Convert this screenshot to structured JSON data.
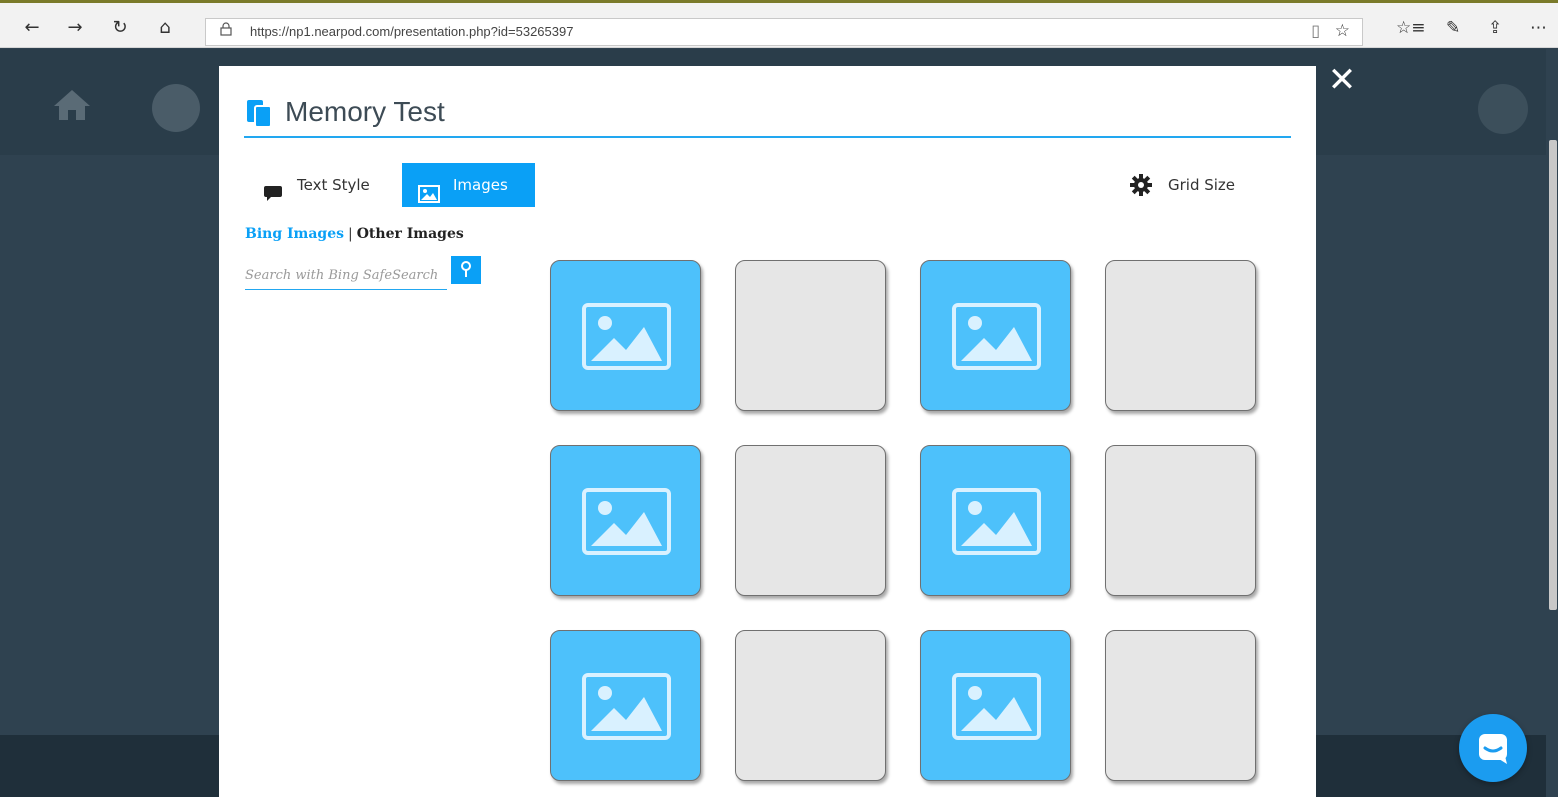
{
  "browser": {
    "url": "https://np1.nearpod.com/presentation.php?id=53265397",
    "icons": [
      "back-arrow-icon",
      "forward-arrow-icon",
      "refresh-icon",
      "home-icon",
      "lock-icon",
      "reading-view-icon",
      "favorite-star-icon",
      "favorites-list-icon",
      "pen-icon",
      "share-icon",
      "more-icon"
    ],
    "glyphs": {
      "back": "←",
      "forward": "→",
      "refresh": "↻",
      "home": "⌂",
      "lock": "🔒",
      "reader": "▯",
      "star": "☆",
      "favorites": "☆≡",
      "pen": "✎",
      "share": "⇪",
      "more": "⋯"
    }
  },
  "modal": {
    "title": "Memory Test",
    "close_glyph": "✕",
    "tabs": [
      {
        "label": "Text Style",
        "icon": "speech-bubble-icon",
        "active": false
      },
      {
        "label": "Images",
        "icon": "image-icon",
        "active": true
      }
    ],
    "grid_size_label": "Grid Size",
    "sources": {
      "bing": "Bing Images",
      "separator": "|",
      "other": "Other Images"
    },
    "search": {
      "placeholder": "Search with Bing SafeSearch",
      "value": ""
    },
    "grid": [
      [
        "image",
        "blank",
        "image",
        "blank"
      ],
      [
        "image",
        "blank",
        "image",
        "blank"
      ],
      [
        "image",
        "blank",
        "image",
        "blank"
      ]
    ]
  },
  "colors": {
    "accent": "#0aa0f6",
    "card_image": "#4dc1fb",
    "card_blank": "#e6e6e6",
    "backdrop": "#2f4250"
  }
}
